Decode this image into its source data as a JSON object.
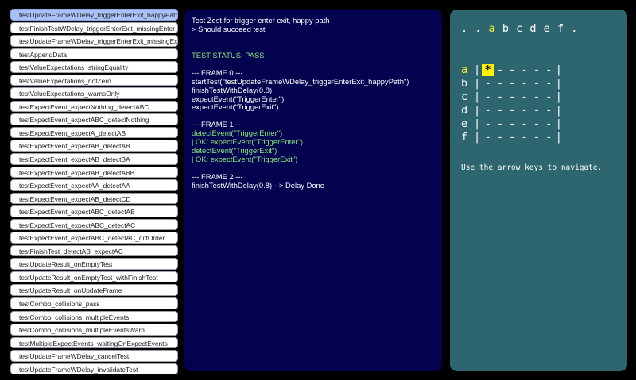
{
  "test_list": {
    "selected_index": 0,
    "items": [
      "testUpdateFrameWDelay_triggerEnterExit_happyPath",
      "testFinishTestWDelay_triggerEnterExit_missingEnter",
      "testUpdateFrameWDelay_triggerEnterExit_missingExit",
      "testAppendData",
      "testValueExpectations_stringEquality",
      "testValueExpectations_notZero",
      "testValueExpectations_warnsOnly",
      "testExpectEvent_expectNothing_detectABC",
      "testExpectEvent_expectABC_detectNothing",
      "testExpectEvent_expectA_detectAB",
      "testExpectEvent_expectAB_detectAB",
      "testExpectEvent_expectAB_detectBA",
      "testExpectEvent_expectAB_detectABB",
      "testExpectEvent_expectAA_detectAA",
      "testExpectEvent_expectAB_detectCD",
      "testExpectEvent_expectABC_detectAB",
      "testExpectEvent_expectABC_detectAC",
      "testExpectEvent_expectABC_detectAC_diffOrder",
      "testFinishTest_detectAB_expectAC",
      "testUpdateResult_onEmptyTest",
      "testUpdateResult_onEmptyTest_withFinishTest",
      "testUpdateResult_onUpdateFrame",
      "testCombo_collisions_pass",
      "testCombo_collisions_multipleEvents",
      "testCombo_collisions_multipleEventsWarn",
      "testMultipleExpectEvents_waitingOnExpectEvents",
      "testUpdateFrameWDelay_cancelTest",
      "testUpdateFrameWDelay_invalidateTest"
    ]
  },
  "console": {
    "lines": [
      {
        "text": "Test Zest for trigger enter exit, happy path",
        "color": "white"
      },
      {
        "text": "> Should succeed test",
        "color": "white"
      },
      {
        "text": "",
        "color": "white"
      },
      {
        "text": "",
        "color": "white"
      },
      {
        "text": "TEST STATUS: PASS",
        "color": "green"
      },
      {
        "text": "",
        "color": "white"
      },
      {
        "text": "--- FRAME 0 ---",
        "color": "white"
      },
      {
        "text": "startTest(\"testUpdateFrameWDelay_triggerEnterExit_happyPath\")",
        "color": "white"
      },
      {
        "text": "finishTestWithDelay(0.8)",
        "color": "white"
      },
      {
        "text": "expectEvent(\"TriggerEnter\")",
        "color": "white"
      },
      {
        "text": "expectEvent(\"TriggerExit\")",
        "color": "white"
      },
      {
        "text": "",
        "color": "white"
      },
      {
        "text": "--- FRAME 1 ---",
        "color": "white"
      },
      {
        "text": "detectEvent(\"TriggerEnter\")",
        "color": "green"
      },
      {
        "text": "| OK: expectEvent(\"TriggerEnter\")",
        "color": "green"
      },
      {
        "text": "detectEvent(\"TriggerExit\")",
        "color": "green"
      },
      {
        "text": "| OK: expectEvent(\"TriggerExit\")",
        "color": "green"
      },
      {
        "text": "",
        "color": "white"
      },
      {
        "text": "--- FRAME 2 ---",
        "color": "white"
      },
      {
        "text": "finishTestWithDelay(0.8) --> Delay Done",
        "color": "white"
      }
    ]
  },
  "grid": {
    "column_header": [
      ". ",
      ". ",
      "a",
      "b",
      "c",
      "d",
      "e",
      "f",
      "."
    ],
    "highlight_column": "a",
    "rows": [
      {
        "label": "a",
        "cells": [
          "*",
          "-",
          "-",
          "-",
          "-",
          "-"
        ]
      },
      {
        "label": "b",
        "cells": [
          "-",
          "-",
          "-",
          "-",
          "-",
          "-"
        ]
      },
      {
        "label": "c",
        "cells": [
          "-",
          "-",
          "-",
          "-",
          "-",
          "-"
        ]
      },
      {
        "label": "d",
        "cells": [
          "-",
          "-",
          "-",
          "-",
          "-",
          "-"
        ]
      },
      {
        "label": "e",
        "cells": [
          "-",
          "-",
          "-",
          "-",
          "-",
          "-"
        ]
      },
      {
        "label": "f",
        "cells": [
          "-",
          "-",
          "-",
          "-",
          "-",
          "-"
        ]
      }
    ],
    "highlight_row": "a",
    "cursor": {
      "row": 0,
      "col": 0
    },
    "bar_char": "|",
    "hint": "Use the arrow keys to navigate."
  },
  "colors": {
    "page_background": "#000000",
    "console_background": "#02024f",
    "console_text": "#ffffff",
    "console_green": "#86e879",
    "grid_panel_background": "#2e6670",
    "grid_highlight": "#f1ea2c",
    "cursor_background": "#fff200",
    "selected_item_background": "#a9c1f6"
  }
}
